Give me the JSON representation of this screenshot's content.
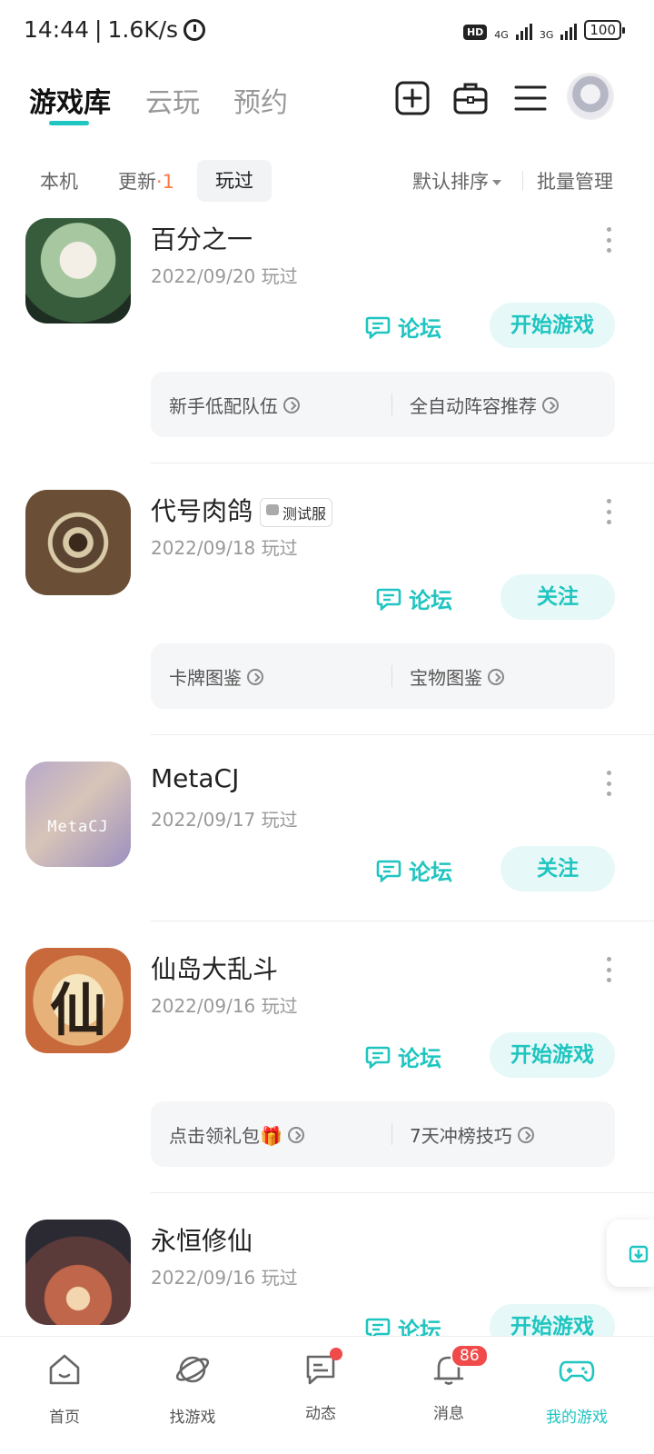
{
  "status_bar": {
    "time": "14:44",
    "net_speed": "1.6K/s",
    "hd": "HD",
    "sim1": "4G",
    "sim2": "3G",
    "battery": "100"
  },
  "header": {
    "tabs": [
      {
        "label": "游戏库",
        "active": true
      },
      {
        "label": "云玩",
        "active": false
      },
      {
        "label": "预约",
        "active": false
      }
    ],
    "accent_color": "#1fc5c0"
  },
  "filters": {
    "local": "本机",
    "update_label": "更新",
    "update_count": "·1",
    "played": "玩过",
    "sort": "默认排序",
    "batch": "批量管理"
  },
  "games": [
    {
      "name": "百分之一",
      "date": "2022/09/20 玩过",
      "forum": "论坛",
      "action": "开始游戏",
      "links": [
        "新手低配队伍",
        "全自动阵容推荐"
      ]
    },
    {
      "name": "代号肉鸽",
      "tag": "测试服",
      "date": "2022/09/18 玩过",
      "forum": "论坛",
      "action": "关注",
      "links": [
        "卡牌图鉴",
        "宝物图鉴"
      ]
    },
    {
      "name": "MetaCJ",
      "icon_text": "MetaCJ",
      "date": "2022/09/17 玩过",
      "forum": "论坛",
      "action": "关注"
    },
    {
      "name": "仙岛大乱斗",
      "icon_text": "仙",
      "date": "2022/09/16 玩过",
      "forum": "论坛",
      "action": "开始游戏",
      "links": [
        "点击领礼包🎁",
        "7天冲榜技巧"
      ]
    },
    {
      "name": "永恒修仙",
      "date": "2022/09/16 玩过",
      "forum": "论坛",
      "action": "开始游戏"
    }
  ],
  "bottom_nav": [
    {
      "label": "首页",
      "icon": "home-icon"
    },
    {
      "label": "找游戏",
      "icon": "planet-icon"
    },
    {
      "label": "动态",
      "icon": "chat-icon"
    },
    {
      "label": "消息",
      "icon": "bell-icon",
      "badge": "86"
    },
    {
      "label": "我的游戏",
      "icon": "gamepad-icon",
      "active": true
    }
  ]
}
